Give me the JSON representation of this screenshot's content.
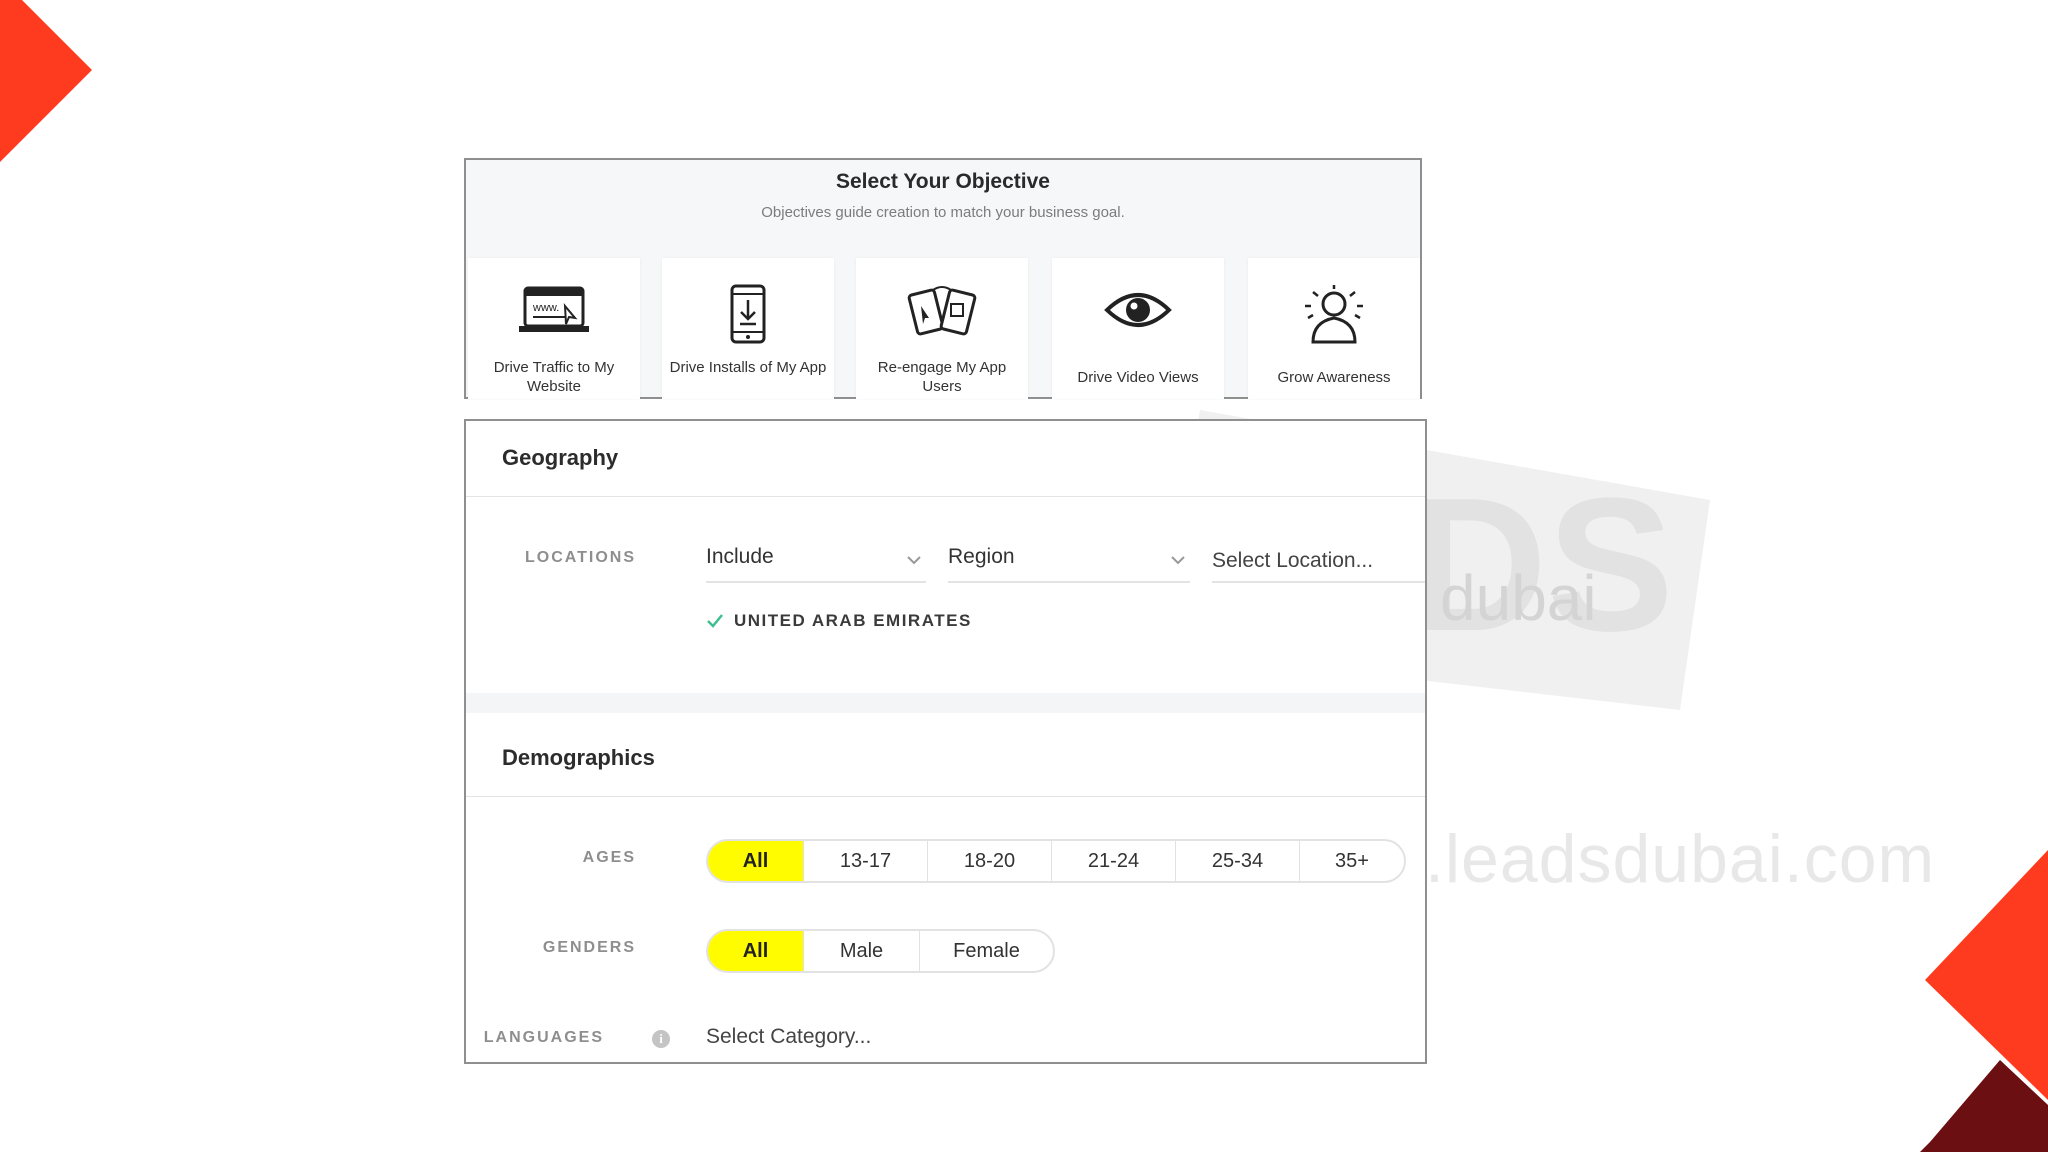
{
  "objective": {
    "title": "Select Your Objective",
    "subtitle": "Objectives guide creation to match your business goal.",
    "cards": [
      {
        "label": "Drive Traffic to My Website",
        "icon": "website-icon"
      },
      {
        "label": "Drive Installs of My App",
        "icon": "app-install-icon"
      },
      {
        "label": "Re-engage My App Users",
        "icon": "re-engage-icon"
      },
      {
        "label": "Drive Video Views",
        "icon": "eye-icon"
      },
      {
        "label": "Grow Awareness",
        "icon": "awareness-icon"
      }
    ]
  },
  "geography": {
    "title": "Geography",
    "locations_label": "LOCATIONS",
    "include_value": "Include",
    "region_value": "Region",
    "location_placeholder": "Select Location...",
    "selected_location": "UNITED ARAB EMIRATES"
  },
  "demographics": {
    "title": "Demographics",
    "ages_label": "AGES",
    "ages": [
      "All",
      "13-17",
      "18-20",
      "21-24",
      "25-34",
      "35+"
    ],
    "ages_selected": "All",
    "genders_label": "GENDERS",
    "genders": [
      "All",
      "Male",
      "Female"
    ],
    "genders_selected": "All",
    "languages_label": "LANGUAGES",
    "languages_placeholder": "Select Category..."
  },
  "watermark": {
    "text": ".leadsdubai.com",
    "logo_text": "dubai"
  },
  "colors": {
    "accent_yellow": "#fffc00",
    "corner_red": "#ff3b1f",
    "corner_dark": "#6b0f12",
    "check_green": "#3fbf8f"
  }
}
